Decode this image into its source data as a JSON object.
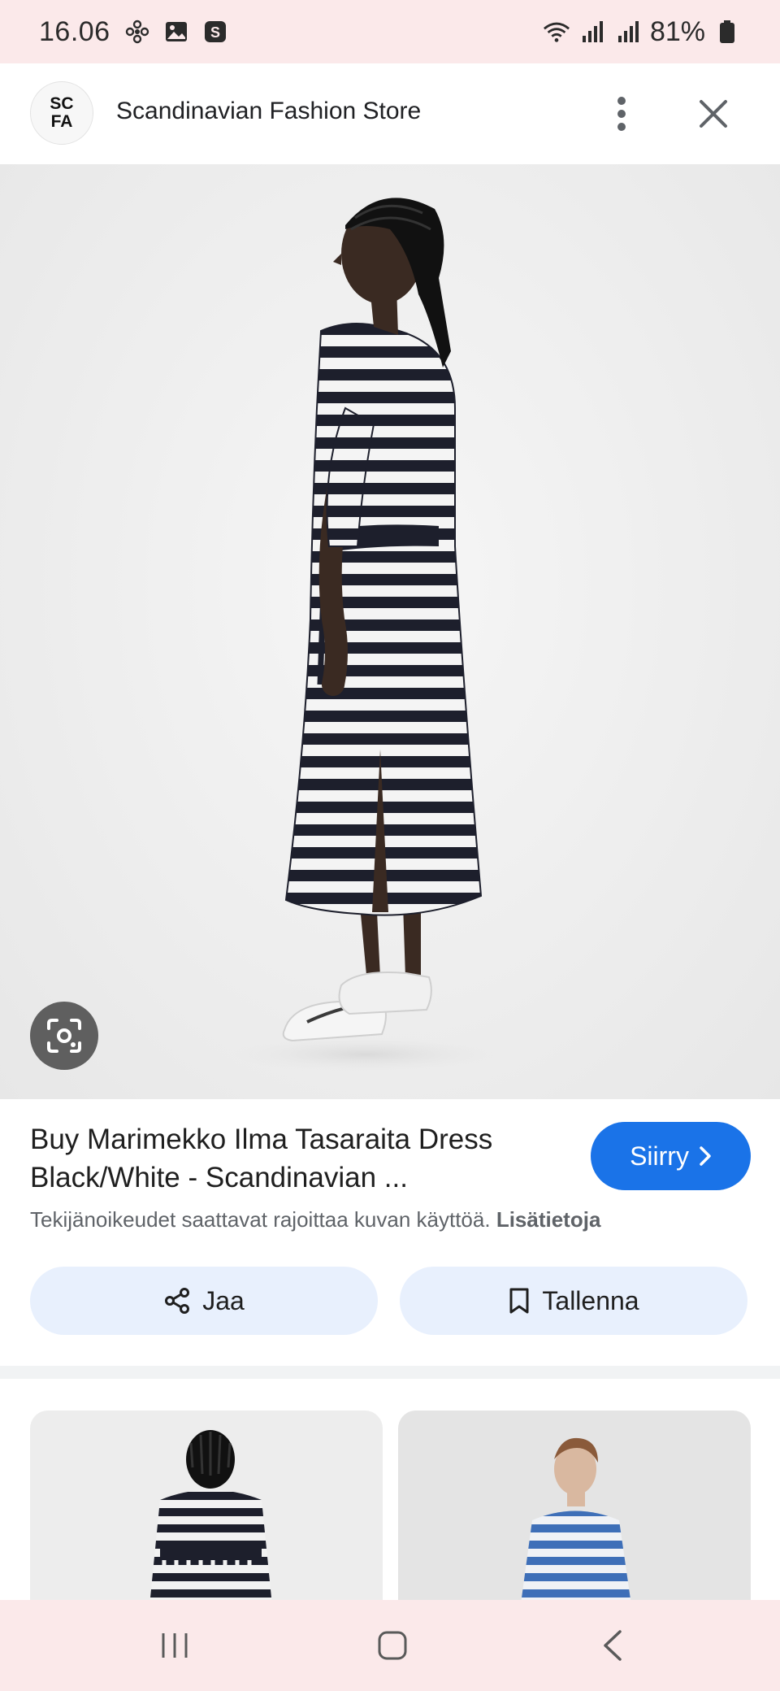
{
  "status_bar": {
    "time": "16.06",
    "battery": "81%",
    "left_icons": [
      "fan-icon",
      "gallery-icon",
      "s-app-icon"
    ],
    "right_icons": [
      "wifi-icon",
      "signal-icon",
      "signal-icon",
      "battery-icon"
    ]
  },
  "header": {
    "logo_line1": "SC",
    "logo_line2": "FA",
    "site_name": "Scandinavian Fashion Store"
  },
  "result": {
    "title": "Buy Marimekko Ilma Tasaraita Dress Black/White - Scandinavian ...",
    "go_label": "Siirry",
    "copyright": "Tekijänoikeudet saattavat rajoittaa kuvan käyttöä.",
    "more_info": "Lisätietoja",
    "share_label": "Jaa",
    "save_label": "Tallenna"
  },
  "colors": {
    "accent": "#1a73e8",
    "chip_bg": "#e8f0fd",
    "system_bar": "#fbe9ea"
  }
}
